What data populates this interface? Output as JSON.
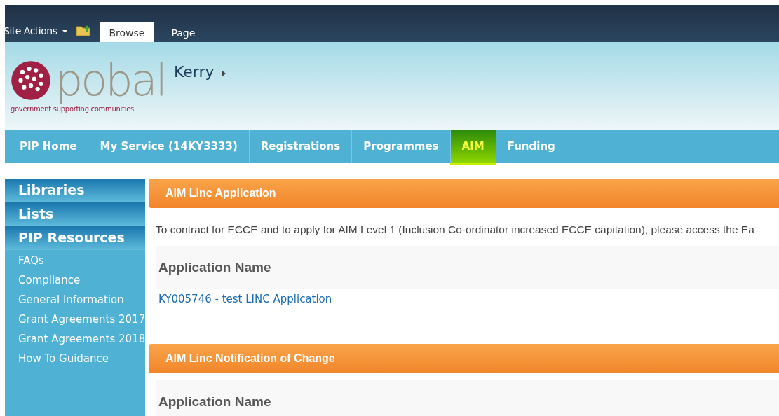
{
  "ribbon": {
    "site_actions": "Site Actions",
    "tabs": [
      {
        "label": "Browse",
        "selected": true
      },
      {
        "label": "Page",
        "selected": false
      }
    ]
  },
  "header": {
    "logo_word": "pobal",
    "tagline": "government supporting communities",
    "breadcrumb": "Kerry"
  },
  "nav": [
    {
      "label": "PIP Home",
      "selected": false
    },
    {
      "label": "My Service (14KY3333)",
      "selected": false
    },
    {
      "label": "Registrations",
      "selected": false
    },
    {
      "label": "Programmes",
      "selected": false
    },
    {
      "label": "AIM",
      "selected": true
    },
    {
      "label": "Funding",
      "selected": false
    }
  ],
  "sidebar": {
    "headings": [
      "Libraries",
      "Lists",
      "PIP Resources"
    ],
    "items": [
      "FAQs",
      "Compliance",
      "General Information",
      "Grant Agreements 2017",
      "Grant Agreements 2018",
      "How To Guidance"
    ]
  },
  "sections": [
    {
      "title": "AIM Linc Application",
      "intro": "To contract for ECCE and to apply for AIM Level 1 (Inclusion Co-ordinator increased ECCE capitation), please access the Ea",
      "column": "Application Name",
      "links": [
        "KY005746 - test LINC Application"
      ]
    },
    {
      "title": "AIM Linc Notification of Change",
      "column": "Application Name"
    }
  ]
}
